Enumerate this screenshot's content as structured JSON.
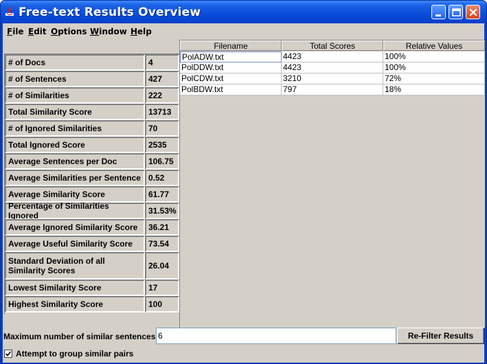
{
  "window": {
    "title": "Free-text Results Overview"
  },
  "menu": [
    "File",
    "Edit",
    "Options",
    "Window",
    "Help"
  ],
  "stats": [
    {
      "label": "# of Docs",
      "value": "4"
    },
    {
      "label": "# of Sentences",
      "value": "427"
    },
    {
      "label": "# of Similarities",
      "value": "222"
    },
    {
      "label": "Total Similarity Score",
      "value": "13713"
    },
    {
      "label": "# of Ignored Similarities",
      "value": "70"
    },
    {
      "label": "Total Ignored Score",
      "value": "2535"
    },
    {
      "label": "Average Sentences per Doc",
      "value": "106.75"
    },
    {
      "label": "Average Similarities per Sentence",
      "value": "0.52"
    },
    {
      "label": "Average Similarity Score",
      "value": "61.77"
    },
    {
      "label": "Percentage of Similarities Ignored",
      "value": "31.53%"
    },
    {
      "label": "Average Ignored Similarity Score",
      "value": "36.21"
    },
    {
      "label": "Average Useful Similarity Score",
      "value": "73.54"
    },
    {
      "label": "Standard Deviation of all Similarity Scores",
      "value": "26.04"
    },
    {
      "label": "Lowest Similarity Score",
      "value": "17"
    },
    {
      "label": "Highest Similarity Score",
      "value": "100"
    }
  ],
  "table": {
    "columns": [
      "Filename",
      "Total Scores",
      "Relative Values"
    ],
    "rows": [
      [
        "PolADW.txt",
        "4423",
        "100%"
      ],
      [
        "PolDDW.txt",
        "4423",
        "100%"
      ],
      [
        "PolCDW.txt",
        "3210",
        "72%"
      ],
      [
        "PolBDW.txt",
        "797",
        "18%"
      ]
    ]
  },
  "filter": {
    "label": "Maximum number of similar sentences",
    "value": "6",
    "button": "Re-Filter Results"
  },
  "group": {
    "label": "Attempt to group similar pairs",
    "checked": true
  },
  "colors": {
    "titlebar": "#0a4fdc",
    "panel": "#d4d0c8",
    "close_button": "#d4461e"
  }
}
